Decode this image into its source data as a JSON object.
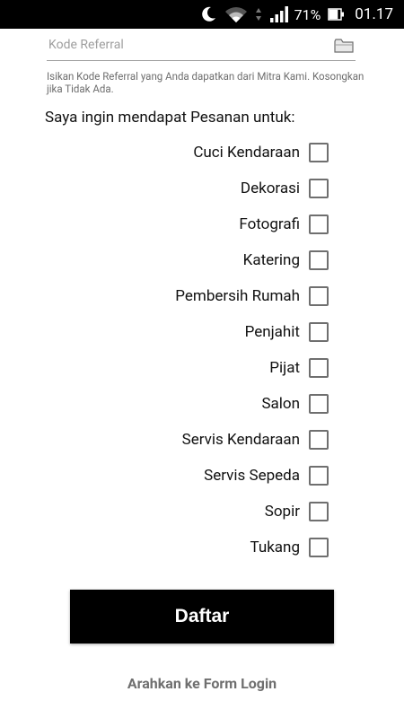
{
  "status_bar": {
    "battery_percent": "71%",
    "time": "01.17",
    "icons": [
      "moon-icon",
      "wifi-icon",
      "signal-icon",
      "battery-icon"
    ]
  },
  "referral": {
    "placeholder": "Kode Referral",
    "value": "",
    "helper": "Isikan Kode Referral yang Anda dapatkan dari Mitra Kami. Kosongkan jika Tidak Ada.",
    "icon": "folder-icon"
  },
  "section_title": "Saya ingin mendapat Pesanan untuk:",
  "services": [
    {
      "label": "Cuci Kendaraan",
      "checked": false
    },
    {
      "label": "Dekorasi",
      "checked": false
    },
    {
      "label": "Fotografi",
      "checked": false
    },
    {
      "label": "Katering",
      "checked": false
    },
    {
      "label": "Pembersih Rumah",
      "checked": false
    },
    {
      "label": "Penjahit",
      "checked": false
    },
    {
      "label": "Pijat",
      "checked": false
    },
    {
      "label": "Salon",
      "checked": false
    },
    {
      "label": "Servis Kendaraan",
      "checked": false
    },
    {
      "label": "Servis Sepeda",
      "checked": false
    },
    {
      "label": "Sopir",
      "checked": false
    },
    {
      "label": "Tukang",
      "checked": false
    }
  ],
  "submit_label": "Daftar",
  "login_link": "Arahkan ke Form Login",
  "colors": {
    "button_bg": "#000000",
    "button_text": "#ffffff",
    "link_text": "#6f6f6f",
    "checkbox_border": "#6f6f6f"
  }
}
